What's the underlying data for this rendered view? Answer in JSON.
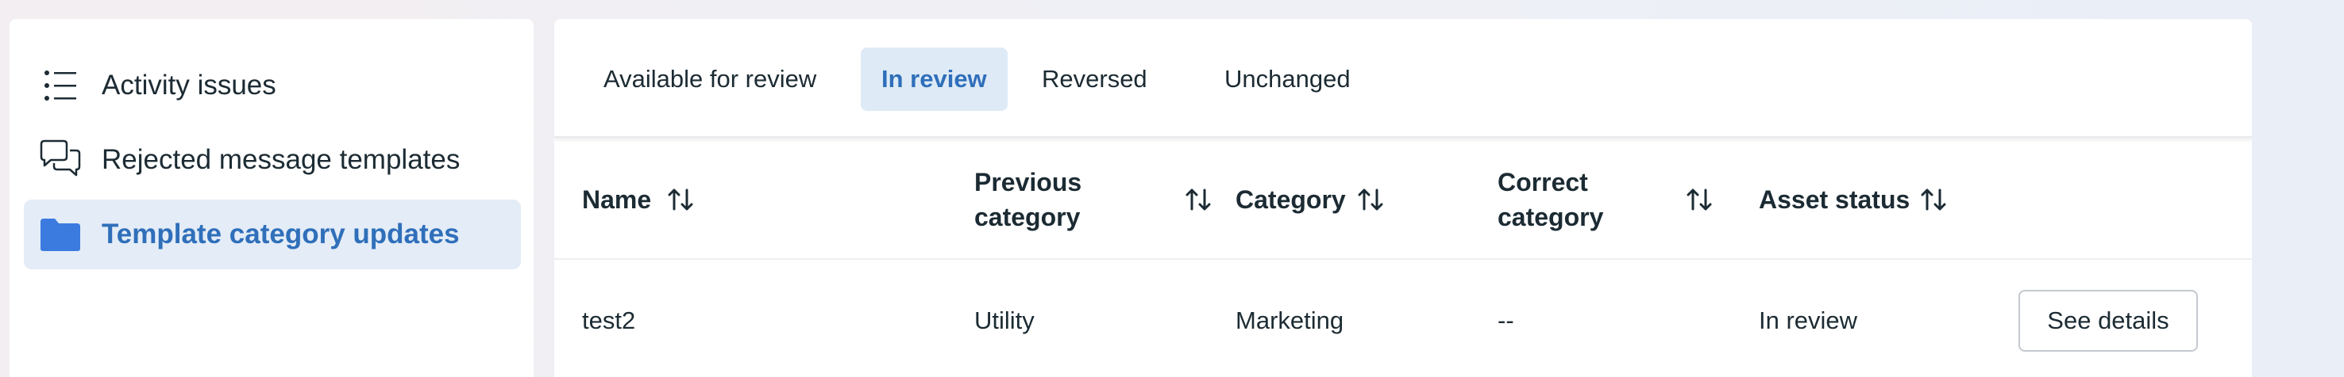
{
  "sidebar": {
    "items": [
      {
        "label": "Activity issues",
        "icon": "list-icon"
      },
      {
        "label": "Rejected message templates",
        "icon": "speech-bubbles-icon"
      },
      {
        "label": "Template category updates",
        "icon": "folder-icon",
        "active": true
      }
    ]
  },
  "tabs": [
    {
      "label": "Available for review"
    },
    {
      "label": "In review",
      "active": true
    },
    {
      "label": "Reversed"
    },
    {
      "label": "Unchanged"
    }
  ],
  "table": {
    "columns": [
      {
        "label": "Name"
      },
      {
        "label": "Previous category"
      },
      {
        "label": "Category"
      },
      {
        "label": "Correct category"
      },
      {
        "label": "Asset status"
      }
    ],
    "rows": [
      {
        "name": "test2",
        "previous_category": "Utility",
        "category": "Marketing",
        "correct_category": "--",
        "asset_status": "In review",
        "action_label": "See details"
      }
    ]
  },
  "colors": {
    "accent": "#2f6fba",
    "active_bg": "#e3ecf7",
    "folder": "#3b7be0"
  }
}
